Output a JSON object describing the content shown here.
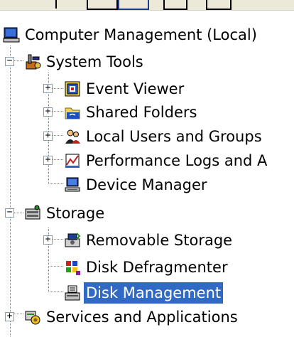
{
  "tree": {
    "root": {
      "label": "Computer Management (Local)",
      "icon": "computer-management-icon"
    },
    "system_tools": {
      "label": "System Tools",
      "icon": "system-tools-icon",
      "expanded": true
    },
    "event_viewer": {
      "label": "Event Viewer",
      "icon": "event-viewer-icon"
    },
    "shared_folders": {
      "label": "Shared Folders",
      "icon": "shared-folders-icon"
    },
    "local_users": {
      "label": "Local Users and Groups",
      "icon": "local-users-icon"
    },
    "performance_logs": {
      "label": "Performance Logs and A",
      "icon": "performance-logs-icon"
    },
    "device_manager": {
      "label": "Device Manager",
      "icon": "device-manager-icon"
    },
    "storage": {
      "label": "Storage",
      "icon": "storage-icon",
      "expanded": true
    },
    "removable_storage": {
      "label": "Removable Storage",
      "icon": "removable-storage-icon"
    },
    "disk_defragmenter": {
      "label": "Disk Defragmenter",
      "icon": "disk-defragmenter-icon"
    },
    "disk_management": {
      "label": "Disk Management",
      "icon": "disk-management-icon",
      "selected": true
    },
    "services_apps": {
      "label": "Services and Applications",
      "icon": "services-applications-icon"
    }
  },
  "expander": {
    "plus": "+",
    "minus": "−"
  },
  "colors": {
    "selection": "#316ac5",
    "tree_lines": "#808080",
    "expander_border": "#7f9db9"
  }
}
